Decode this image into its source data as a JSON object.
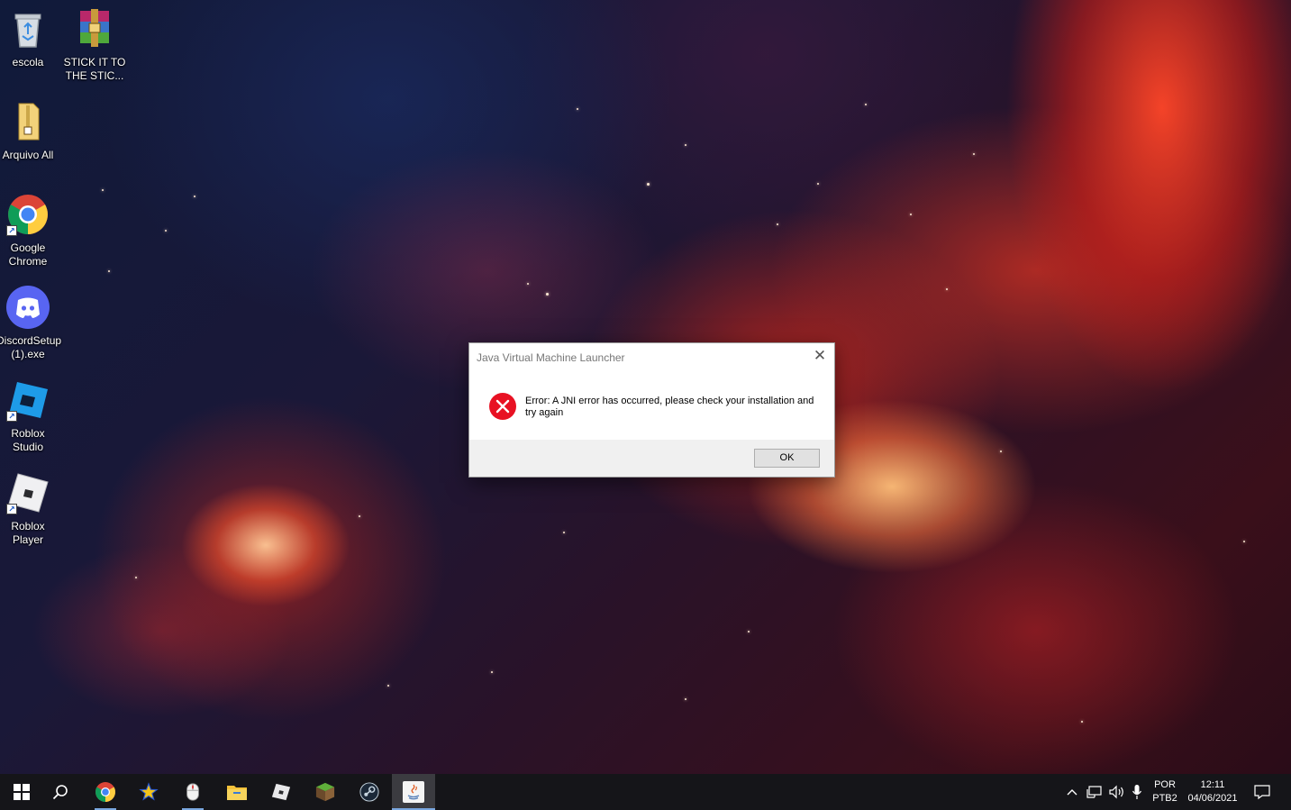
{
  "desktop": {
    "icons": [
      {
        "label": "escola",
        "icon": "recycle-bin-icon"
      },
      {
        "label": "STICK IT TO THE STIC...",
        "icon": "winrar-archive-icon"
      },
      {
        "label": "Arquivo All",
        "icon": "folder-zip-icon"
      },
      {
        "label": "Google Chrome",
        "icon": "chrome-icon"
      },
      {
        "label": "DiscordSetup (1).exe",
        "icon": "discord-icon"
      },
      {
        "label": "Roblox Studio",
        "icon": "roblox-studio-icon"
      },
      {
        "label": "Roblox Player",
        "icon": "roblox-player-icon"
      }
    ]
  },
  "dialog": {
    "title": "Java Virtual Machine Launcher",
    "close_label": "✕",
    "message": "Error: A JNI error has occurred, please check your installation and try again",
    "ok_label": "OK",
    "icon": "error-icon"
  },
  "taskbar": {
    "items": [
      {
        "name": "start-button",
        "icon": "windows-logo-icon"
      },
      {
        "name": "search-button",
        "icon": "search-icon"
      },
      {
        "name": "chrome-taskbar",
        "icon": "chrome-icon"
      },
      {
        "name": "star-app-taskbar",
        "icon": "star-icon"
      },
      {
        "name": "mouse-app-taskbar",
        "icon": "mouse-icon"
      },
      {
        "name": "file-explorer-taskbar",
        "icon": "folder-icon"
      },
      {
        "name": "roblox-taskbar",
        "icon": "roblox-icon"
      },
      {
        "name": "minecraft-taskbar",
        "icon": "minecraft-icon"
      },
      {
        "name": "steam-taskbar",
        "icon": "steam-icon"
      },
      {
        "name": "java-taskbar",
        "icon": "java-icon"
      }
    ],
    "tray": {
      "language_top": "POR",
      "language_bottom": "PTB2",
      "time": "12:11",
      "date": "04/06/2021"
    }
  },
  "colors": {
    "error_red": "#e81123",
    "taskbar_bg": "#151519",
    "accent_blue": "#7aa7e0"
  }
}
